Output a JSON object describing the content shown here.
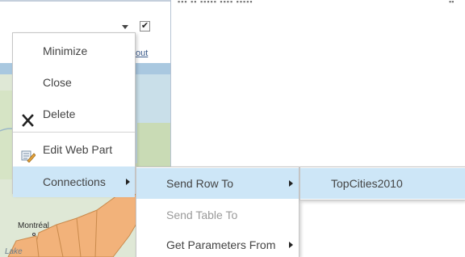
{
  "colors": {
    "menu_hover": "#cde6f7",
    "menu_border": "#c6c6c6",
    "text": "#444444",
    "disabled_text": "#9a9a9a",
    "map_region": "#f2b27a"
  },
  "webpart": {
    "partial_link_text": "out",
    "checkbox_checked": true,
    "map_labels": [
      "Montréal",
      "Lake"
    ]
  },
  "menu": {
    "items": [
      {
        "label": "Minimize",
        "icon": null
      },
      {
        "label": "Close",
        "icon": null
      },
      {
        "label": "Delete",
        "icon": "close-x-icon"
      },
      {
        "label": "Edit Web Part",
        "icon": "edit-webpart-icon"
      },
      {
        "label": "Connections",
        "icon": null,
        "has_submenu": true,
        "active": true
      }
    ]
  },
  "connections_submenu": {
    "items": [
      {
        "label": "Send Row To",
        "has_submenu": true,
        "active": true,
        "disabled": false
      },
      {
        "label": "Send Table To",
        "has_submenu": false,
        "active": false,
        "disabled": true
      },
      {
        "label": "Get Parameters From",
        "has_submenu": true,
        "active": false,
        "disabled": false
      }
    ]
  },
  "send_row_submenu": {
    "items": [
      {
        "label": "TopCities2010"
      }
    ]
  }
}
